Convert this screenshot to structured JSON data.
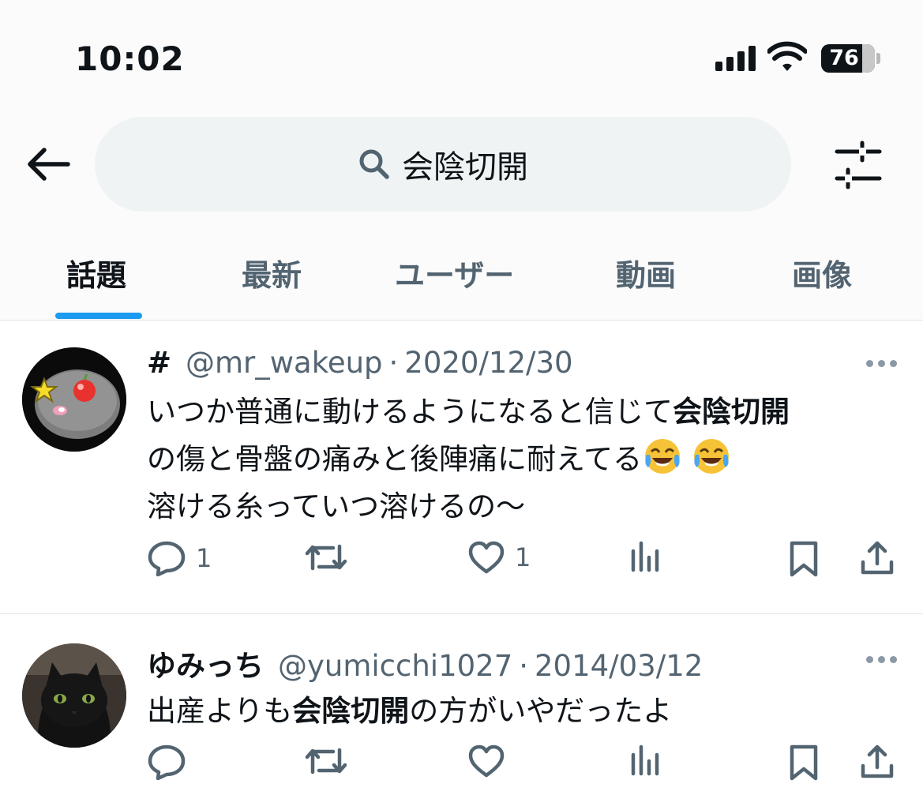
{
  "status": {
    "time": "10:02",
    "battery": "76"
  },
  "search": {
    "query": "会陰切開"
  },
  "tabs": [
    {
      "label": "話題",
      "active": true
    },
    {
      "label": "最新",
      "active": false
    },
    {
      "label": "ユーザー",
      "active": false
    },
    {
      "label": "動画",
      "active": false
    },
    {
      "label": "画像",
      "active": false
    }
  ],
  "posts": [
    {
      "display_name": "#",
      "handle": "@mr_wakeup",
      "separator": "·",
      "date": "2020/12/30",
      "text": {
        "line1_pre": "いつか普通に動けるようになると信じて",
        "line1_bold": "会陰切開",
        "line2": "の傷と骨盤の痛みと後陣痛に耐えてる",
        "line3": "溶ける糸っていつ溶けるの〜"
      },
      "emoji": [
        "face-with-tears-of-joy",
        "face-with-tears-of-joy"
      ],
      "reply_count": "1",
      "like_count": "1"
    },
    {
      "display_name": "ゆみっち",
      "handle": "@yumicchi1027",
      "separator": "·",
      "date": "2014/03/12",
      "text": {
        "pre": "出産よりも",
        "bold": "会陰切開",
        "post": "の方がいやだったよ"
      }
    }
  ],
  "colors": {
    "accent": "#1d9bf0",
    "text": "#0f1419",
    "secondary": "#536471",
    "search_bg": "#eff3f4",
    "divider": "#e1e4e8"
  }
}
